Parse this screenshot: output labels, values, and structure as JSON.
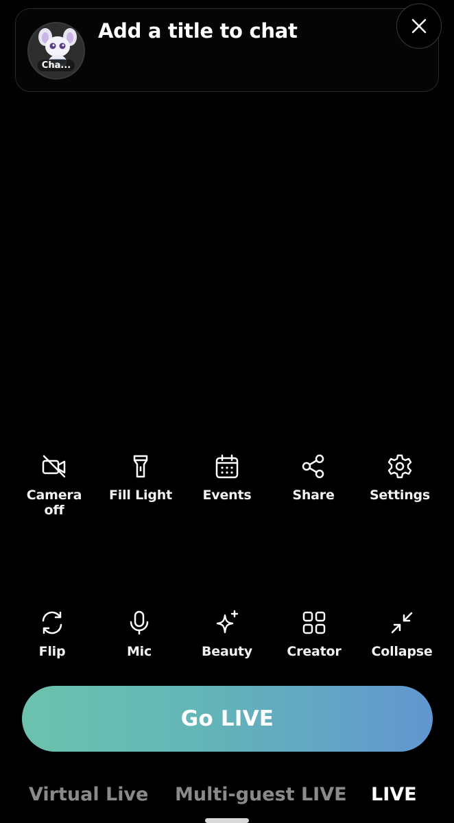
{
  "header": {
    "avatar_label": "Cha...",
    "title": "Add a title to chat"
  },
  "tools_row1": [
    {
      "label": "Camera off",
      "icon": "camera-off-icon"
    },
    {
      "label": "Fill Light",
      "icon": "flashlight-icon"
    },
    {
      "label": "Events",
      "icon": "calendar-icon"
    },
    {
      "label": "Share",
      "icon": "share-icon"
    },
    {
      "label": "Settings",
      "icon": "gear-icon"
    }
  ],
  "tools_row2": [
    {
      "label": "Flip",
      "icon": "flip-camera-icon"
    },
    {
      "label": "Mic",
      "icon": "microphone-icon"
    },
    {
      "label": "Beauty",
      "icon": "sparkle-icon"
    },
    {
      "label": "Creator",
      "icon": "grid-icon"
    },
    {
      "label": "Collapse",
      "icon": "collapse-icon"
    }
  ],
  "go_live_label": "Go LIVE",
  "modes": [
    {
      "label": "Virtual Live",
      "active": false
    },
    {
      "label": "Multi-guest LIVE",
      "active": false
    },
    {
      "label": "LIVE",
      "active": true
    }
  ],
  "colors": {
    "background": "#000000",
    "go_live_gradient_start": "#6cc2ad",
    "go_live_gradient_end": "#6296d0",
    "inactive_mode": "#8a8a8a"
  }
}
